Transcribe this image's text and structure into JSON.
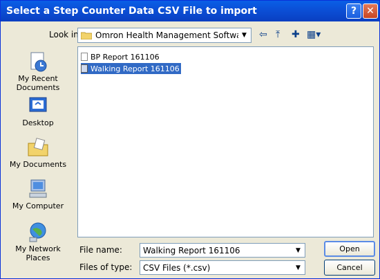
{
  "window": {
    "title": "Select a Step Counter Data CSV File to import",
    "help_label": "?",
    "close_label": "✕"
  },
  "lookin": {
    "label": "Look in:",
    "value": "Omron Health Management Software"
  },
  "places": [
    {
      "label": "My Recent Documents",
      "icon": "recent-documents-icon"
    },
    {
      "label": "Desktop",
      "icon": "desktop-icon"
    },
    {
      "label": "My Documents",
      "icon": "my-documents-icon"
    },
    {
      "label": "My Computer",
      "icon": "my-computer-icon"
    },
    {
      "label": "My Network Places",
      "icon": "network-places-icon"
    }
  ],
  "files": [
    {
      "name": "BP Report 161106",
      "selected": false
    },
    {
      "name": "Walking Report 161106",
      "selected": true
    }
  ],
  "filename": {
    "label": "File name:",
    "value": "Walking Report 161106"
  },
  "filetype": {
    "label": "Files of type:",
    "value": "CSV Files (*.csv)"
  },
  "buttons": {
    "open": "Open",
    "cancel": "Cancel"
  },
  "colors": {
    "title_bar": "#0a5fe6",
    "selection": "#316ac5",
    "dialog_bg": "#ece9d8"
  }
}
